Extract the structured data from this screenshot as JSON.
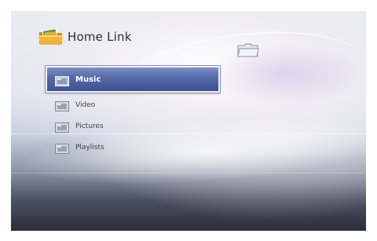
{
  "app": {
    "title": "Home Link",
    "icon": "photo-folder-icon"
  },
  "toolbar": {
    "folder_icon": "folder-icon"
  },
  "menu": {
    "selected_index": 0,
    "items": [
      {
        "label": "Music",
        "icon": "folder-icon"
      },
      {
        "label": "Video",
        "icon": "folder-icon"
      },
      {
        "label": "Pictures",
        "icon": "folder-icon"
      },
      {
        "label": "Playlists",
        "icon": "folder-icon"
      }
    ]
  },
  "colors": {
    "selection": "#5467a6",
    "selection_border": "#eef1f8",
    "text": "#3d434e"
  }
}
